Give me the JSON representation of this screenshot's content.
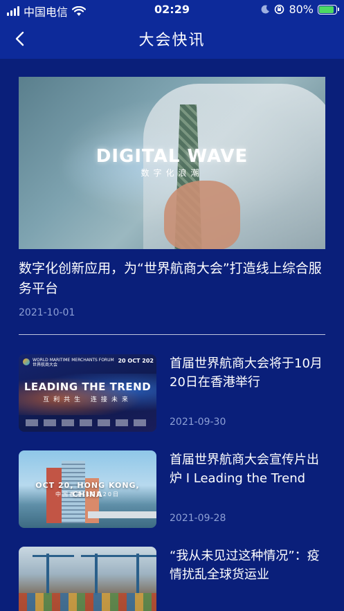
{
  "status_bar": {
    "carrier": "中国电信",
    "time": "02:29",
    "battery_percent": "80%",
    "battery_level": 0.8
  },
  "nav": {
    "title": "大会快讯"
  },
  "featured": {
    "image_title": "DIGITAL WAVE",
    "image_subtitle": "数字化浪潮",
    "title": "数字化创新应用，为“世界航商大会”打造线上综合服务平台",
    "date": "2021-10-01"
  },
  "news": [
    {
      "title": "首届世界航商大会将于10月20日在香港举行",
      "date": "2021-09-30",
      "thumb": {
        "headline": "LEADING THE TREND",
        "subline": "互利共生 连接未来",
        "forum": "WORLD MARITIME MERCHANTS FORUM",
        "forum_cn": "世界航商大会",
        "date_badge": "20 OCT 202"
      }
    },
    {
      "title": "首届世界航商大会宣传片出炉 I Leading the Trend",
      "date": "2021-09-28",
      "thumb": {
        "headline": "OCT 20, HONG KONG, CHINA",
        "subline": "中国香港 10月20日"
      }
    },
    {
      "title": "“我从未见过这种情况”：疫情扰乱全球货运业",
      "date": ""
    }
  ],
  "colors": {
    "background": "#0a1f7a",
    "header": "#0d2a9a",
    "date_text": "#8ea0d6",
    "battery_fill": "#4cd964"
  },
  "icons": [
    "signal-icon",
    "wifi-icon",
    "moon-icon",
    "orientation-lock-icon",
    "battery-icon",
    "chevron-left-icon"
  ]
}
